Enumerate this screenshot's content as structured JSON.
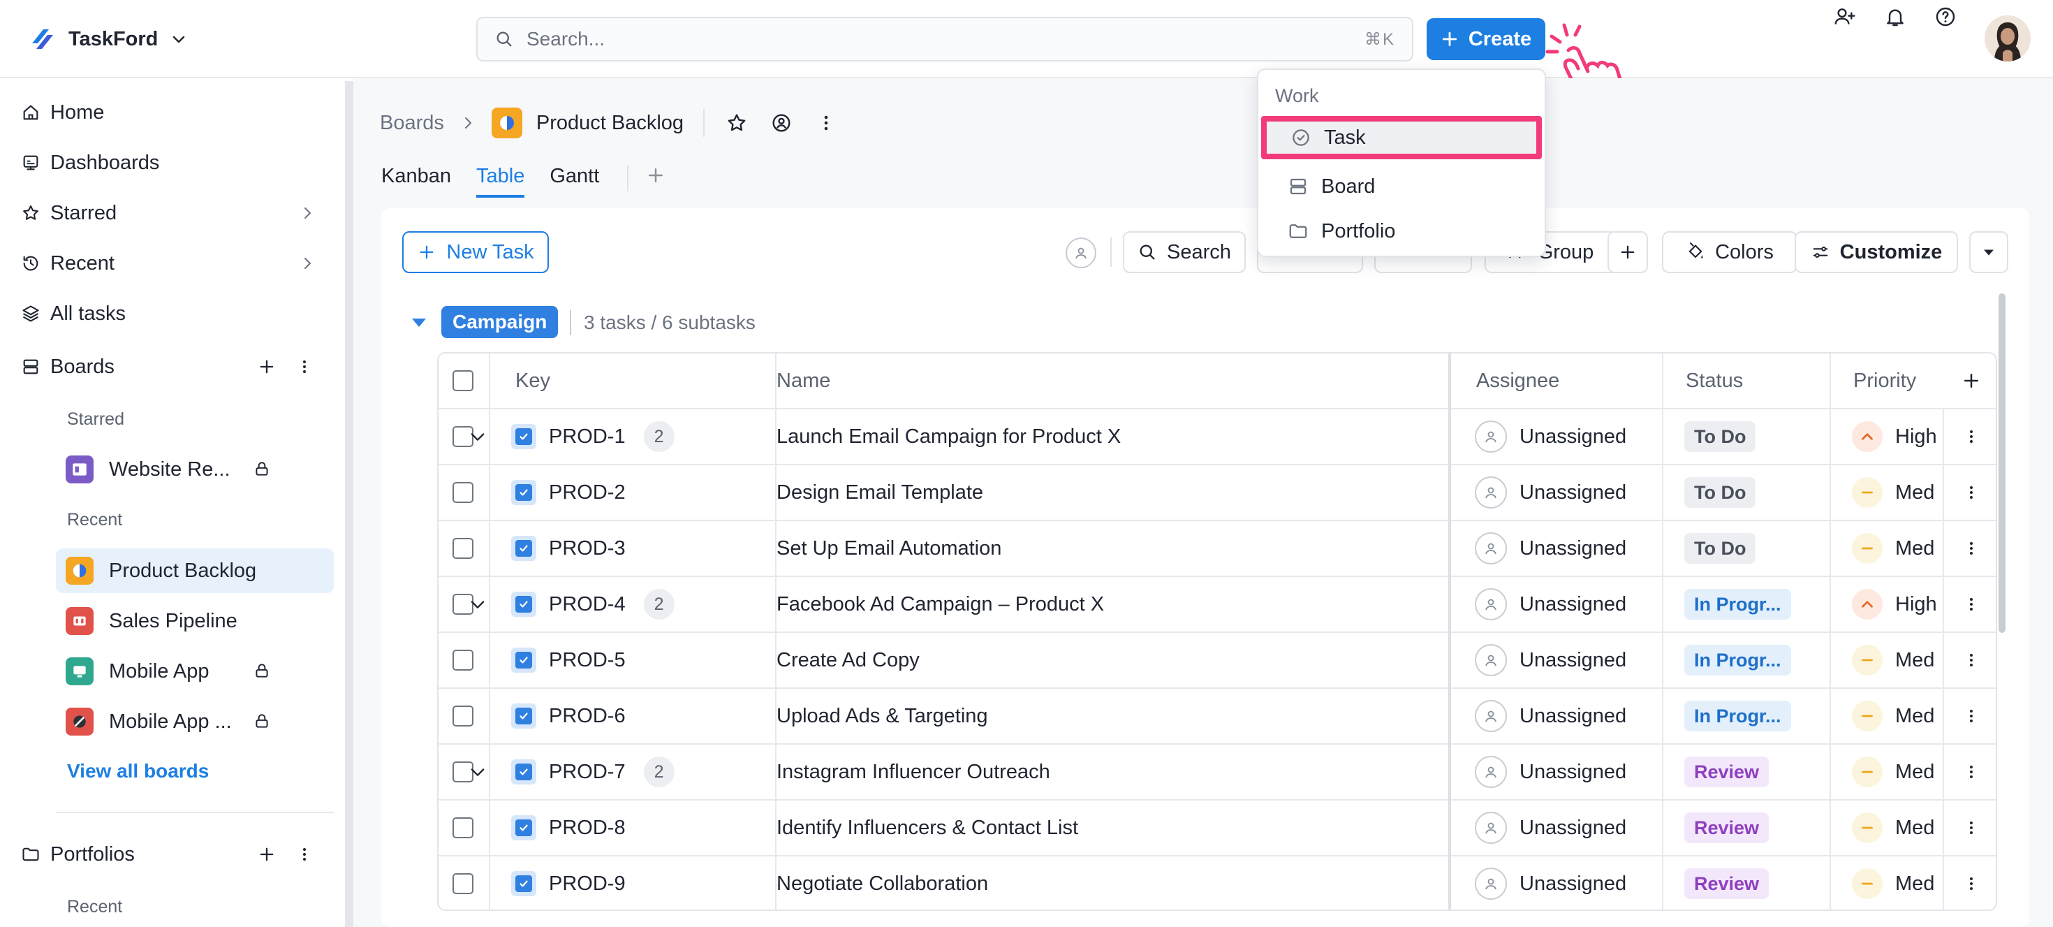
{
  "app": {
    "name": "TaskFord"
  },
  "search": {
    "placeholder": "Search...",
    "shortcut": "⌘K"
  },
  "create": {
    "label": "Create"
  },
  "create_menu": {
    "header": "Work",
    "items": [
      {
        "label": "Task",
        "icon": "check-circle-icon",
        "highlighted": true
      },
      {
        "label": "Board",
        "icon": "board-icon"
      },
      {
        "label": "Portfolio",
        "icon": "folder-icon"
      }
    ]
  },
  "sidebar": {
    "nav": [
      {
        "label": "Home",
        "icon": "home-icon"
      },
      {
        "label": "Dashboards",
        "icon": "dashboard-icon"
      },
      {
        "label": "Starred",
        "icon": "star-icon"
      },
      {
        "label": "Recent",
        "icon": "history-icon"
      },
      {
        "label": "All tasks",
        "icon": "layers-icon"
      }
    ],
    "boards": {
      "label": "Boards",
      "starred_label": "Starred",
      "starred": [
        {
          "label": "Website Re...",
          "color": "#7b5cc6",
          "locked": true
        }
      ],
      "recent_label": "Recent",
      "recent": [
        {
          "label": "Product Backlog",
          "color": "#f5a623",
          "locked": false,
          "active": true
        },
        {
          "label": "Sales Pipeline",
          "color": "#e0524a",
          "locked": false
        },
        {
          "label": "Mobile App",
          "color": "#2fa88f",
          "locked": true
        },
        {
          "label": "Mobile App ...",
          "color": "#e0524a",
          "locked": true
        }
      ],
      "view_all": "View all boards"
    },
    "portfolios": {
      "label": "Portfolios",
      "recent_label": "Recent"
    }
  },
  "breadcrumb": {
    "root": "Boards",
    "title": "Product Backlog"
  },
  "views": {
    "tabs": [
      "Kanban",
      "Table",
      "Gantt"
    ],
    "active": "Table"
  },
  "toolbar": {
    "new_task": "New Task",
    "search": "Search",
    "group": "Group",
    "colors": "Colors",
    "customize": "Customize"
  },
  "group": {
    "name": "Campaign",
    "summary": "3 tasks / 6 subtasks"
  },
  "table": {
    "columns": {
      "key": "Key",
      "name": "Name",
      "assignee": "Assignee",
      "status": "Status",
      "priority": "Priority"
    },
    "rows": [
      {
        "key": "PROD-1",
        "subtasks": "2",
        "parent": true,
        "name": "Launch Email Campaign for Product X",
        "assignee": "Unassigned",
        "status": "To Do",
        "priority": "High"
      },
      {
        "key": "PROD-2",
        "parent": false,
        "name": "Design Email Template",
        "assignee": "Unassigned",
        "status": "To Do",
        "priority": "Med"
      },
      {
        "key": "PROD-3",
        "parent": false,
        "name": "Set Up Email Automation",
        "assignee": "Unassigned",
        "status": "To Do",
        "priority": "Med"
      },
      {
        "key": "PROD-4",
        "subtasks": "2",
        "parent": true,
        "name": "Facebook Ad Campaign – Product X",
        "assignee": "Unassigned",
        "status": "In Progr...",
        "priority": "High"
      },
      {
        "key": "PROD-5",
        "parent": false,
        "name": "Create Ad Copy",
        "assignee": "Unassigned",
        "status": "In Progr...",
        "priority": "Med"
      },
      {
        "key": "PROD-6",
        "parent": false,
        "name": "Upload Ads & Targeting",
        "assignee": "Unassigned",
        "status": "In Progr...",
        "priority": "Med"
      },
      {
        "key": "PROD-7",
        "subtasks": "2",
        "parent": true,
        "name": "Instagram Influencer Outreach",
        "assignee": "Unassigned",
        "status": "Review",
        "priority": "Med"
      },
      {
        "key": "PROD-8",
        "parent": false,
        "name": "Identify Influencers & Contact List",
        "assignee": "Unassigned",
        "status": "Review",
        "priority": "Med"
      },
      {
        "key": "PROD-9",
        "parent": false,
        "name": "Negotiate Collaboration",
        "assignee": "Unassigned",
        "status": "Review",
        "priority": "Med"
      }
    ]
  },
  "status_colors": {
    "To Do": {
      "bg": "#eceef1",
      "fg": "#4a505b"
    },
    "In Progr...": {
      "bg": "#e3f0fc",
      "fg": "#1d6fc8"
    },
    "Review": {
      "bg": "#f3e8fb",
      "fg": "#8e3fc0"
    }
  },
  "priority_colors": {
    "High": {
      "bg": "#fde9df",
      "fg": "#e8692d"
    },
    "Med": {
      "bg": "#fdf4dd",
      "fg": "#e9a81b"
    }
  }
}
